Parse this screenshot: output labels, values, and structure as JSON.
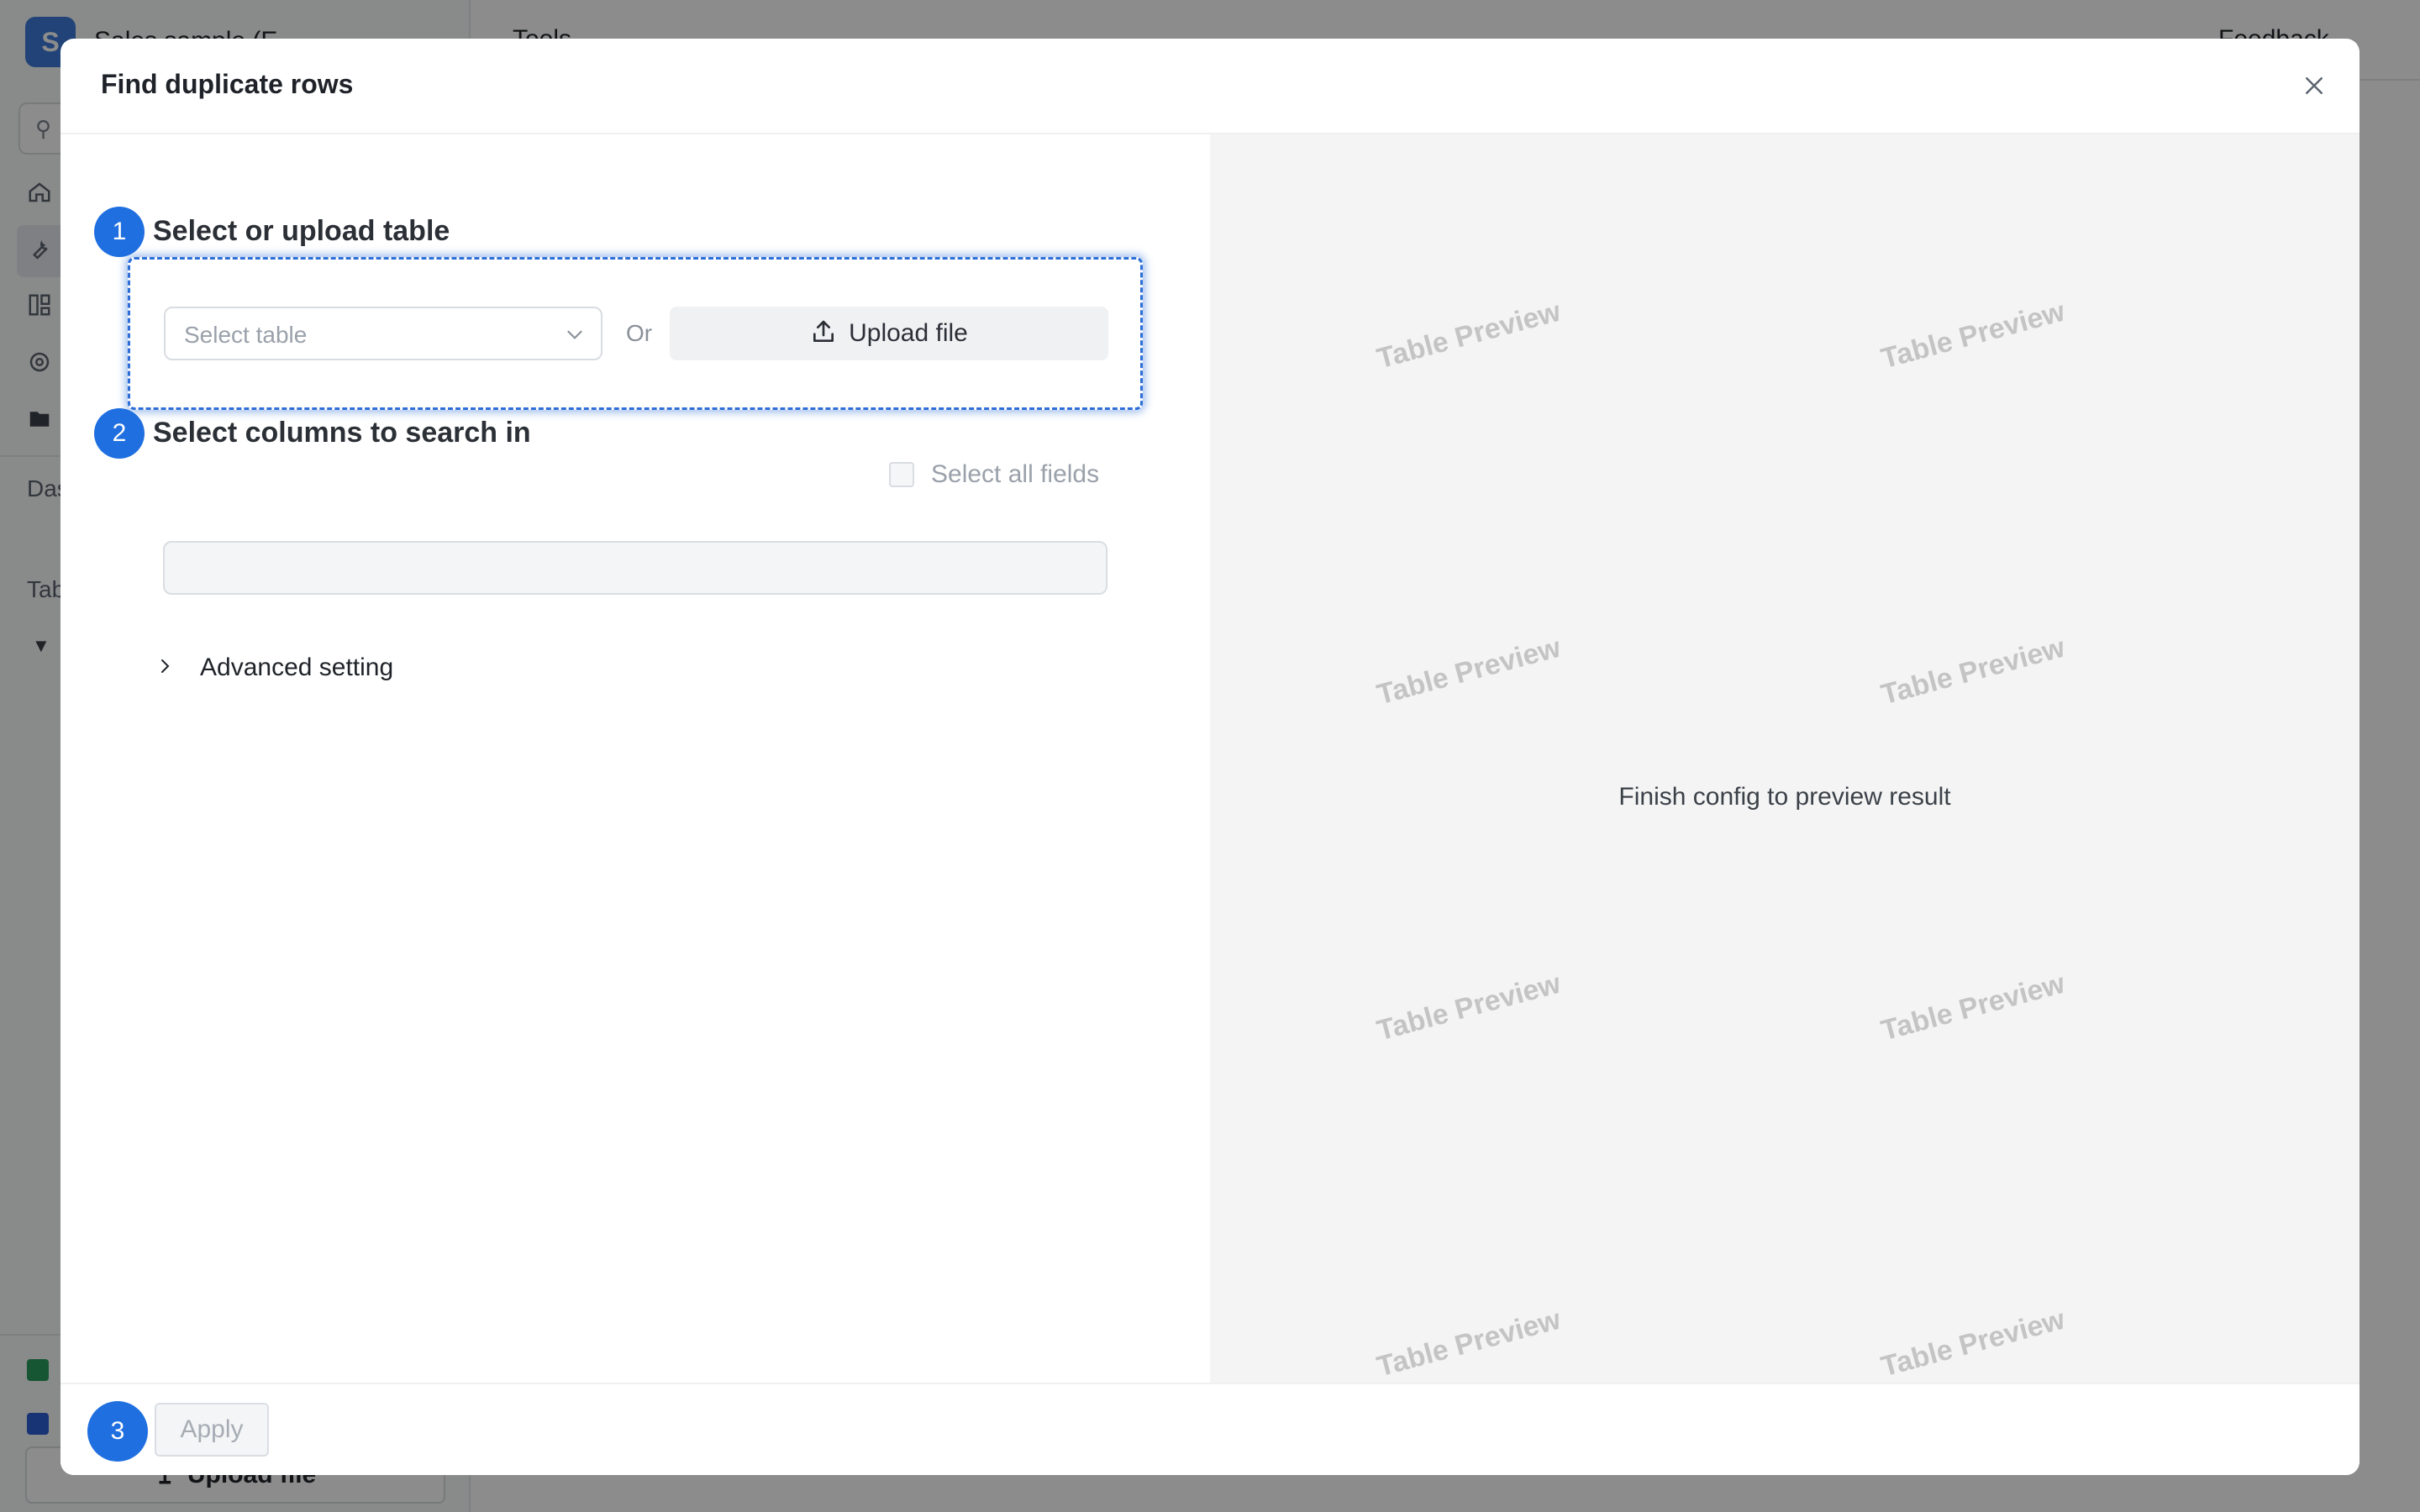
{
  "background_app": {
    "logo_letter": "S",
    "title": "Sales sample (E",
    "topbar_label": "Tools",
    "feedback_label": "Feedback",
    "section_dashboards": "Das",
    "section_tables": "Tab",
    "upload_label": "Upload file"
  },
  "modal": {
    "title": "Find duplicate rows",
    "close_icon": "close-icon"
  },
  "step1": {
    "number": "1",
    "title": "Select or upload table",
    "select_placeholder": "Select table",
    "or_label": "Or",
    "upload_label": "Upload file"
  },
  "step2": {
    "number": "2",
    "title": "Select columns to search in",
    "select_all_label": "Select all fields",
    "select_all_checked": false
  },
  "advanced": {
    "label": "Advanced setting",
    "expanded": false
  },
  "footer": {
    "step_number": "3",
    "apply_label": "Apply",
    "apply_enabled": false
  },
  "preview": {
    "message": "Finish config to preview result",
    "watermarks": [
      "Table Preview",
      "Table Preview",
      "Table Preview",
      "Table Preview",
      "Table Preview",
      "Table Preview",
      "Table Preview",
      "Table Preview"
    ]
  },
  "colors": {
    "accent": "#1f6fe0",
    "overlay": "rgba(0,0,0,0.45)",
    "preview_bg": "#f4f4f4"
  }
}
